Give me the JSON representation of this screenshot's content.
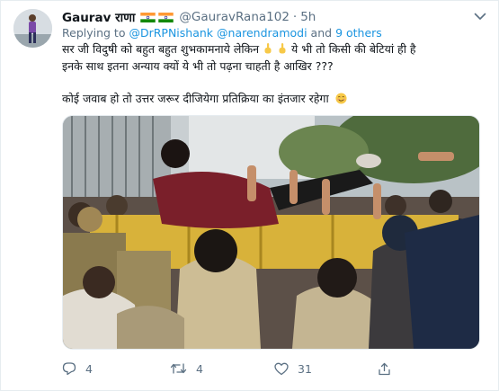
{
  "tweet": {
    "author": {
      "name": "Gaurav राणा",
      "handle": "@GauravRana102",
      "flags": [
        "india-flag",
        "india-flag"
      ]
    },
    "time": "5h",
    "separator": "·",
    "replying_prefix": "Replying to",
    "replying_to": [
      "@DrRPNishank",
      "@narendramodi"
    ],
    "replying_and": "and",
    "replying_others": "9 others",
    "text": {
      "line1_a": "सर जी विदुषी को बहुत बहुत शुभकामनाये लेकिन",
      "line1_b": "ये भी तो किसी की बेटियां ही है",
      "line2": "इनके साथ इतना अन्याय क्यों ये भी तो पढ़ना चाहती है आखिर ???",
      "line3": "कोई जवाब हो तो उत्तर जरूर दीजियेगा प्रतिक्रिया का इंतजार रहेगा"
    },
    "emojis": [
      "pointing-up-emoji",
      "pointing-up-emoji",
      "smiling-face-emoji"
    ],
    "media": {
      "type": "photo",
      "alt_icon": "photo"
    },
    "actions": {
      "reply_count": "4",
      "retweet_count": "4",
      "like_count": "31"
    }
  },
  "colors": {
    "link": "#1b95e0",
    "secondary_text": "#5b7083",
    "border": "#e6ecf0",
    "flag_saffron": "#ff9933",
    "flag_green": "#138808",
    "flag_chakra": "#000080"
  }
}
